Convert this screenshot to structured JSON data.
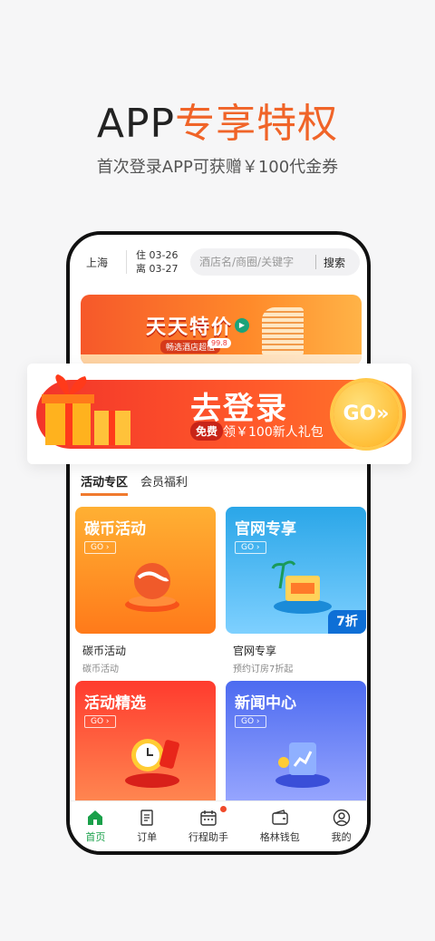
{
  "hero": {
    "title_part1": "APP",
    "title_part2": "专享特权",
    "subtitle": "首次登录APP可获赠￥100代金券"
  },
  "search_bar": {
    "city": "上海",
    "checkin": "住 03-26",
    "checkout": "离 03-27",
    "placeholder": "酒店名/商圈/关键字",
    "button": "搜索"
  },
  "promo_banner": {
    "title": "天天特价",
    "tag": "畅选酒店超值",
    "price": "99.8"
  },
  "login_banner": {
    "main": "去登录",
    "free_tag": "免费",
    "sub": "领￥100新人礼包",
    "go": "GO»"
  },
  "tabs": [
    {
      "label": "活动专区",
      "active": true
    },
    {
      "label": "会员福利",
      "active": false
    }
  ],
  "cards": [
    {
      "title": "碳币活动",
      "go": "GO ›",
      "caption": "碳币活动",
      "desc": "碳币活动"
    },
    {
      "title": "官网专享",
      "go": "GO ›",
      "caption": "官网专享",
      "desc": "预约订房7折起",
      "badge": "7折"
    },
    {
      "title": "活动精选",
      "go": "GO ›"
    },
    {
      "title": "新闻中心",
      "go": "GO ›"
    }
  ],
  "nav": [
    {
      "label": "首页",
      "icon": "home-icon",
      "active": true
    },
    {
      "label": "订单",
      "icon": "order-icon"
    },
    {
      "label": "行程助手",
      "icon": "calendar-icon",
      "dot": true
    },
    {
      "label": "格林钱包",
      "icon": "wallet-icon"
    },
    {
      "label": "我的",
      "icon": "profile-icon"
    }
  ],
  "colors": {
    "accent": "#f06428",
    "nav_active": "#1aa04a"
  }
}
